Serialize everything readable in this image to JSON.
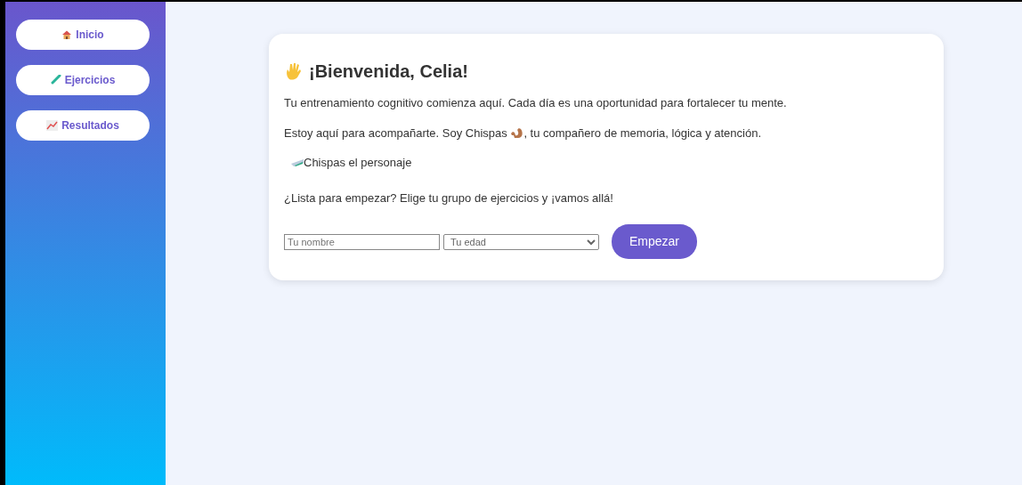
{
  "sidebar": {
    "items": [
      {
        "label": "Inicio"
      },
      {
        "label": "Ejercicios"
      },
      {
        "label": "Resultados"
      }
    ]
  },
  "welcome": {
    "title": "¡Bienvenida, Celia!",
    "intro": "Tu entrenamiento cognitivo comienza aquí. Cada día es una oportunidad para fortalecer tu mente.",
    "companion_before": "Estoy aquí para acompañarte. Soy Chispas",
    "companion_after": ", tu compañero de memoria, lógica y atención.",
    "image_alt": "Chispas el personaje",
    "prompt": "¿Lista para empezar? Elige tu grupo de ejercicios y ¡vamos allá!"
  },
  "form": {
    "name_placeholder": "Tu nombre",
    "age_value": "Tu edad",
    "button": "Empezar"
  }
}
